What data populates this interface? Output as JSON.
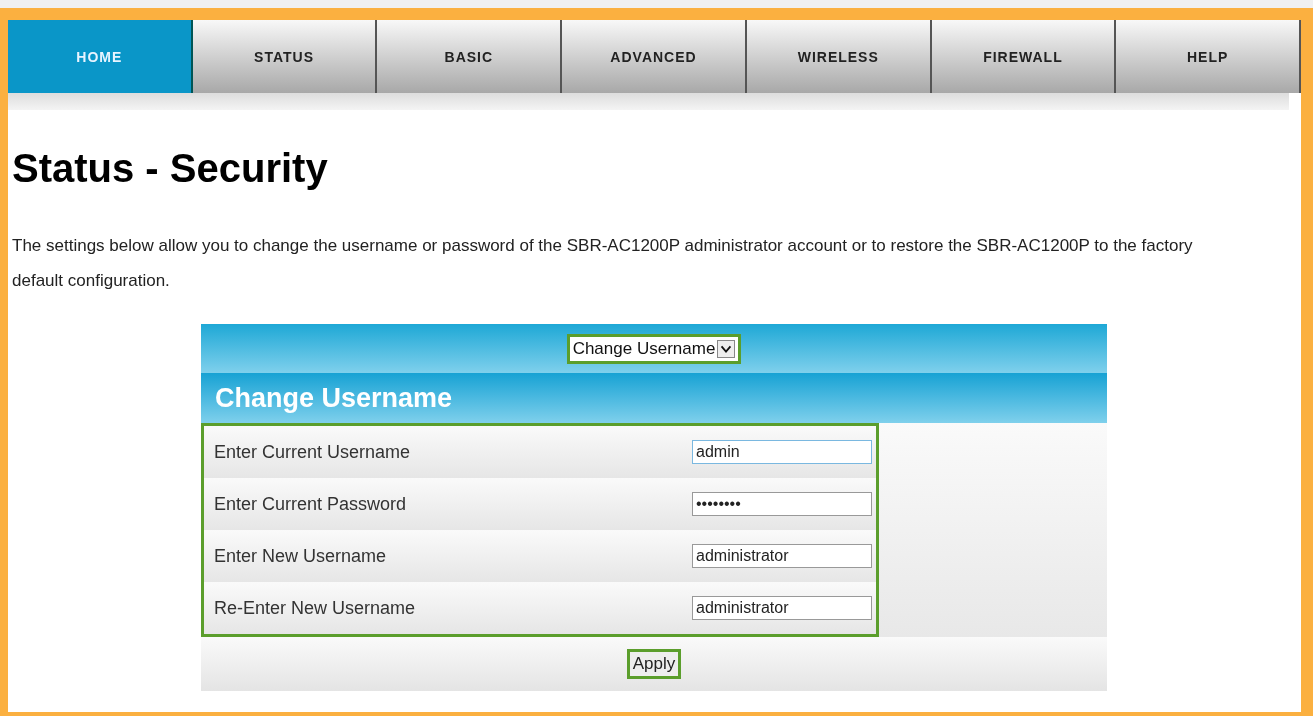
{
  "nav": [
    {
      "label": "HOME",
      "selected": true
    },
    {
      "label": "STATUS",
      "selected": false
    },
    {
      "label": "BASIC",
      "selected": false
    },
    {
      "label": "ADVANCED",
      "selected": false
    },
    {
      "label": "WIRELESS",
      "selected": false
    },
    {
      "label": "FIREWALL",
      "selected": false
    },
    {
      "label": "HELP",
      "selected": false
    }
  ],
  "title": "Status - Security",
  "description": "The settings below allow you to change the username or password of the SBR-AC1200P administrator account or to restore the SBR-AC1200P to the factory default configuration.",
  "panel": {
    "dropdown": {
      "value": "Change Username",
      "highlighted": true
    },
    "heading": "Change Username",
    "fields_highlighted": true,
    "fields": [
      {
        "label": "Enter Current Username",
        "value": "admin",
        "focused": true
      },
      {
        "label": "Enter Current Password",
        "value": "••••••••",
        "focused": false
      },
      {
        "label": "Enter New Username",
        "value": "administrator",
        "focused": false
      },
      {
        "label": "Re-Enter New Username",
        "value": "administrator",
        "focused": false
      }
    ],
    "apply": {
      "label": "Apply",
      "highlighted": true
    }
  }
}
